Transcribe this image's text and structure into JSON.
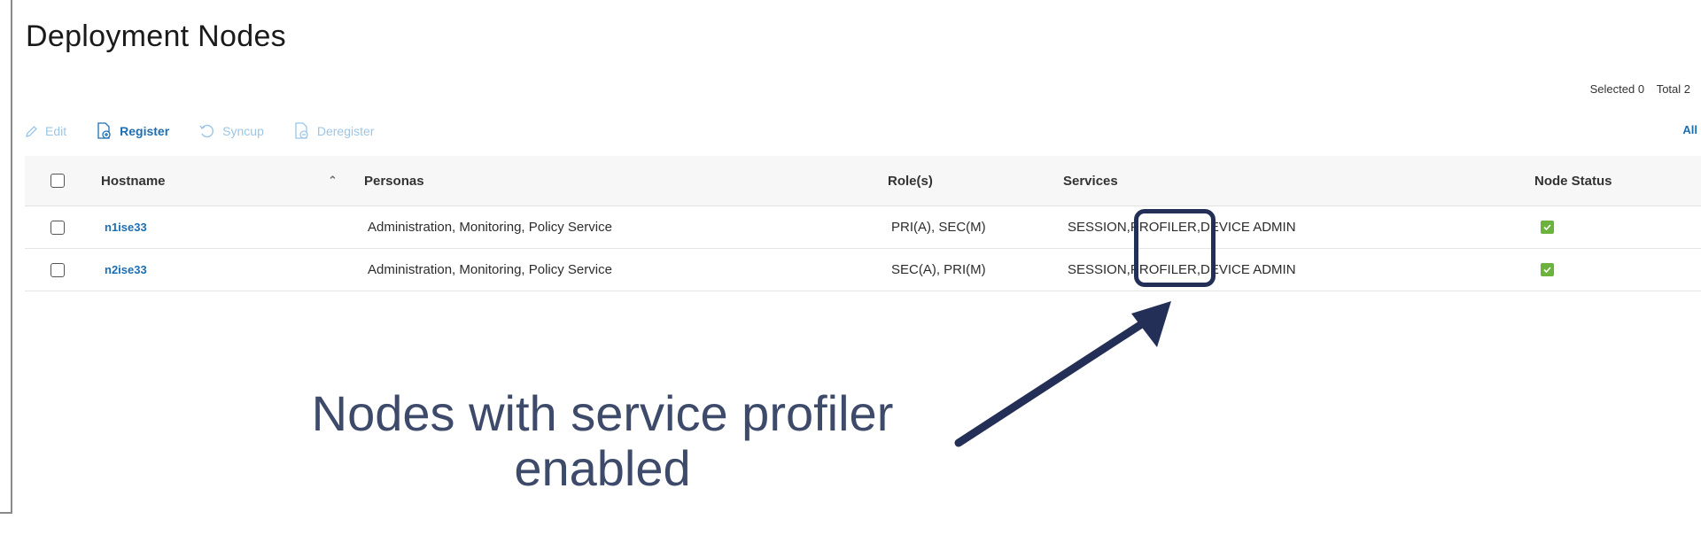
{
  "page": {
    "title": "Deployment Nodes"
  },
  "summary": {
    "selected": "Selected 0",
    "total": "Total 2"
  },
  "toolbar": {
    "edit": "Edit",
    "register": "Register",
    "syncup": "Syncup",
    "deregister": "Deregister",
    "all": "All"
  },
  "table": {
    "columns": {
      "hostname": "Hostname",
      "personas": "Personas",
      "roles": "Role(s)",
      "services": "Services",
      "node_status": "Node Status"
    },
    "rows": [
      {
        "hostname": "n1ise33",
        "personas": "Administration, Monitoring, Policy Service",
        "roles": "PRI(A), SEC(M)",
        "services": "SESSION,PROFILER,DEVICE ADMIN"
      },
      {
        "hostname": "n2ise33",
        "personas": "Administration, Monitoring, Policy Service",
        "roles": "SEC(A), PRI(M)",
        "services": "SESSION,PROFILER,DEVICE ADMIN"
      }
    ]
  },
  "annotation": {
    "line1": "Nodes with service profiler",
    "line2": "enabled"
  },
  "colors": {
    "link": "#1d6fb3",
    "status_ok": "#6cb33e",
    "annotation": "#232f56"
  },
  "icons": {
    "edit": "pencil-icon",
    "register": "register-icon",
    "syncup": "sync-icon",
    "deregister": "deregister-icon",
    "sort": "sort-ascending-icon",
    "status": "checkmark-icon"
  }
}
